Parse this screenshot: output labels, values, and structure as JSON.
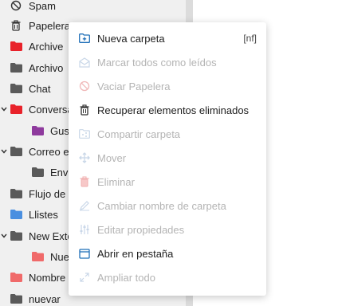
{
  "colors": {
    "accent_blue": "#1f6fb8",
    "red_folder": "#e8222a",
    "purple_folder": "#8e3a9d",
    "salmon_folder": "#f06a6a",
    "blue_folder": "#4a8fe0",
    "gray_folder": "#5a5a5a"
  },
  "sidebar": {
    "folders": [
      {
        "label": "Spam",
        "icon": "ban-icon"
      },
      {
        "label": "Papelera",
        "icon": "trash-icon"
      },
      {
        "label": "Archive",
        "icon": "folder-icon",
        "color": "red"
      },
      {
        "label": "Archivo",
        "icon": "folder-icon",
        "color": "gray"
      },
      {
        "label": "Chat",
        "icon": "folder-icon",
        "color": "gray"
      },
      {
        "label": "Conversa",
        "icon": "folder-icon",
        "color": "red",
        "expanded": true
      },
      {
        "label": "Gus",
        "icon": "folder-icon",
        "color": "purple"
      },
      {
        "label": "Correo e",
        "icon": "folder-icon",
        "color": "gray",
        "expanded": true
      },
      {
        "label": "Envi",
        "icon": "folder-icon",
        "color": "gray"
      },
      {
        "label": "Flujo de a",
        "icon": "folder-icon",
        "color": "gray"
      },
      {
        "label": "Llistes",
        "icon": "folder-icon",
        "color": "blue"
      },
      {
        "label": "New Exte",
        "icon": "folder-icon",
        "color": "gray",
        "expanded": true
      },
      {
        "label": "Nue",
        "icon": "folder-icon",
        "color": "salmon"
      },
      {
        "label": "Nombre",
        "icon": "folder-icon",
        "color": "salmon"
      },
      {
        "label": "nuevar",
        "icon": "folder-icon",
        "color": "gray"
      }
    ]
  },
  "context_menu": {
    "items": [
      {
        "label": "Nueva carpeta",
        "icon": "new-folder-icon",
        "shortcut": "[nf]",
        "enabled": true
      },
      {
        "label": "Marcar todos como leídos",
        "icon": "envelope-open-icon",
        "enabled": false
      },
      {
        "label": "Vaciar Papelera",
        "icon": "ban-icon",
        "enabled": false
      },
      {
        "label": "Recuperar elementos eliminados",
        "icon": "trash-restore-icon",
        "enabled": true
      },
      {
        "label": "Compartir carpeta",
        "icon": "share-folder-icon",
        "enabled": false
      },
      {
        "label": "Mover",
        "icon": "move-icon",
        "enabled": false
      },
      {
        "label": "Eliminar",
        "icon": "trash-icon",
        "enabled": false
      },
      {
        "label": "Cambiar nombre de carpeta",
        "icon": "pencil-icon",
        "enabled": false
      },
      {
        "label": "Editar propiedades",
        "icon": "sliders-icon",
        "enabled": false
      },
      {
        "label": "Abrir en pestaña",
        "icon": "open-tab-icon",
        "enabled": true
      },
      {
        "label": "Ampliar todo",
        "icon": "expand-icon",
        "enabled": false
      }
    ]
  }
}
